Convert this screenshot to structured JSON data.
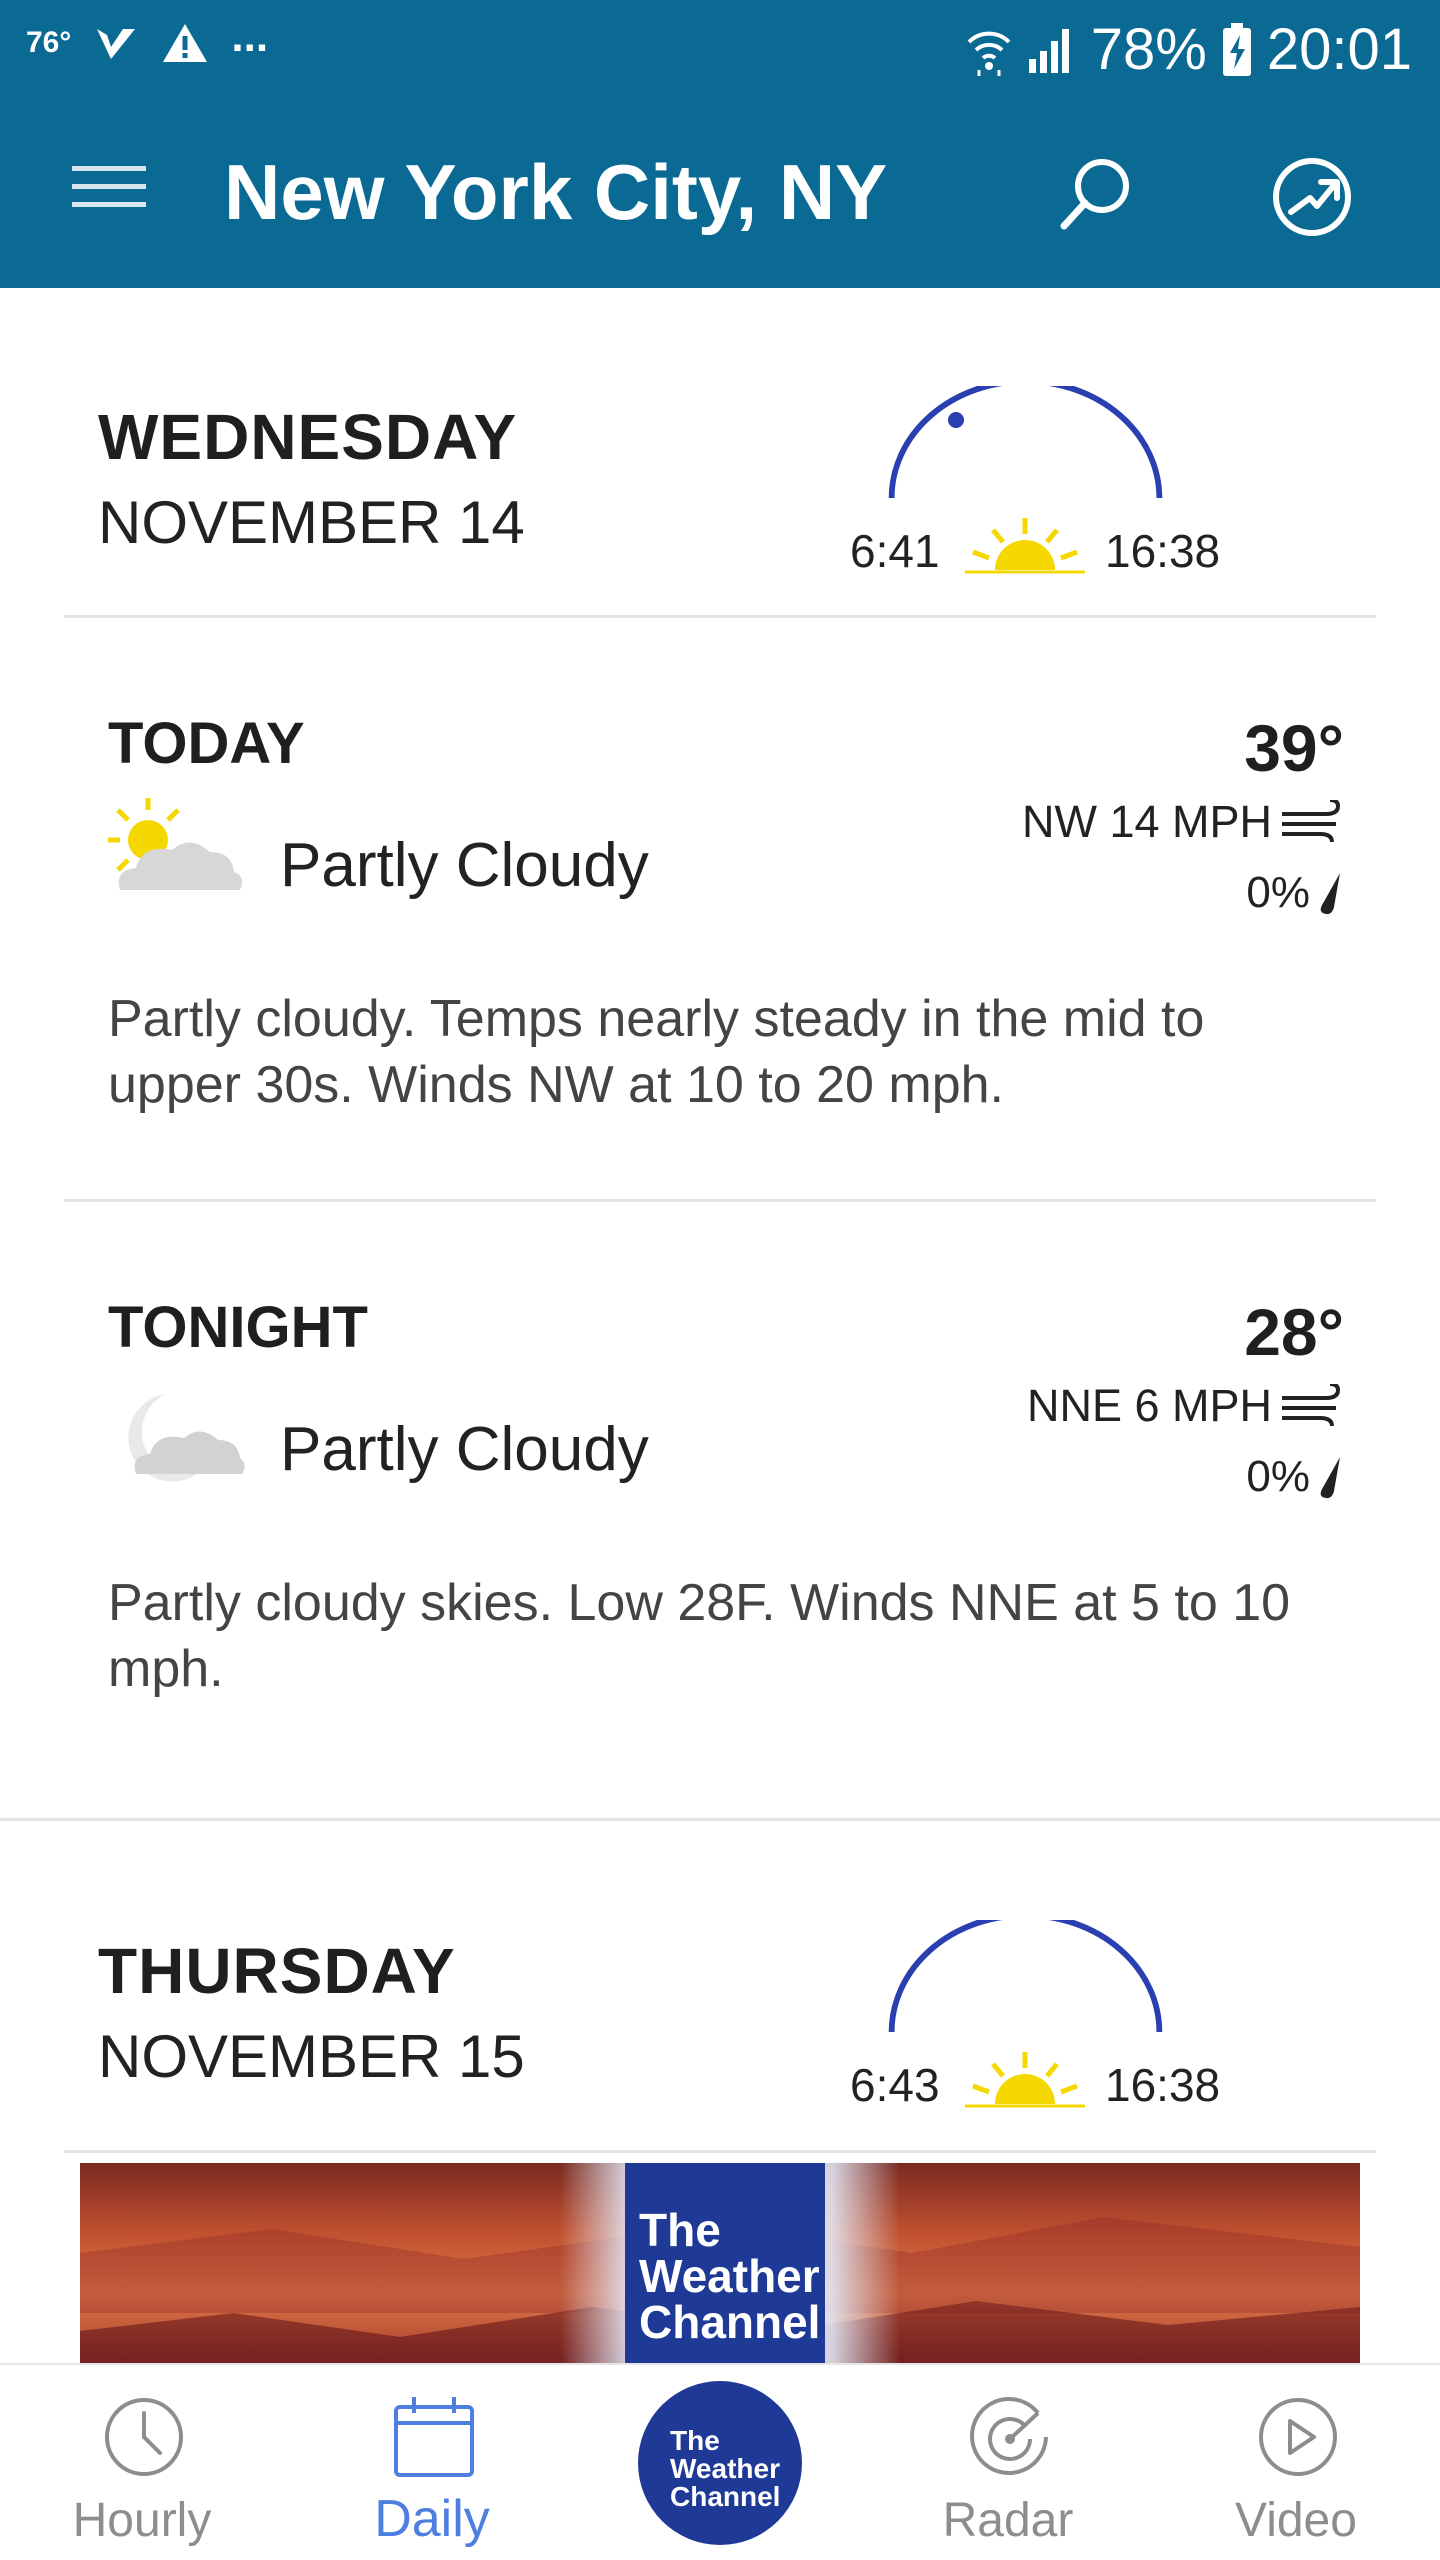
{
  "status_bar": {
    "temp": "76°",
    "overflow": "...",
    "battery": "78%",
    "time": "20:01"
  },
  "app_bar": {
    "title": "New York City, NY",
    "icons": [
      "menu-icon",
      "search-icon",
      "locate-icon"
    ]
  },
  "days": [
    {
      "name": "WEDNESDAY",
      "date": "NOVEMBER 14",
      "sunrise": "6:41",
      "sunset": "16:38",
      "periods": [
        {
          "label": "TODAY",
          "temp": "39°",
          "condition": "Partly Cloudy",
          "icon": "partly-cloudy-day-icon",
          "wind": "NW 14 MPH",
          "precip": "0%",
          "description": "Partly cloudy. Temps nearly steady in the mid to upper 30s. Winds NW at 10 to 20 mph."
        },
        {
          "label": "TONIGHT",
          "temp": "28°",
          "condition": "Partly Cloudy",
          "icon": "partly-cloudy-night-icon",
          "wind": "NNE 6 MPH",
          "precip": "0%",
          "description": "Partly cloudy skies. Low 28F. Winds NNE at 5 to 10 mph."
        }
      ]
    },
    {
      "name": "THURSDAY",
      "date": "NOVEMBER 15",
      "sunrise": "6:43",
      "sunset": "16:38"
    }
  ],
  "ad": {
    "logo_lines": [
      "The",
      "Weather",
      "Channel"
    ]
  },
  "bottom_nav": {
    "items": [
      {
        "label": "Hourly",
        "icon": "clock-icon"
      },
      {
        "label": "Daily",
        "icon": "calendar-icon",
        "active": true
      },
      {
        "label": "Radar",
        "icon": "radar-icon"
      },
      {
        "label": "Video",
        "icon": "play-icon"
      }
    ],
    "center_logo": [
      "The",
      "Weather",
      "Channel"
    ]
  },
  "colors": {
    "header": "#0b6a93",
    "active_nav": "#4e7fe0",
    "arc": "#2a3fb0",
    "sun": "#f5d800",
    "brand": "#1f3a96"
  }
}
